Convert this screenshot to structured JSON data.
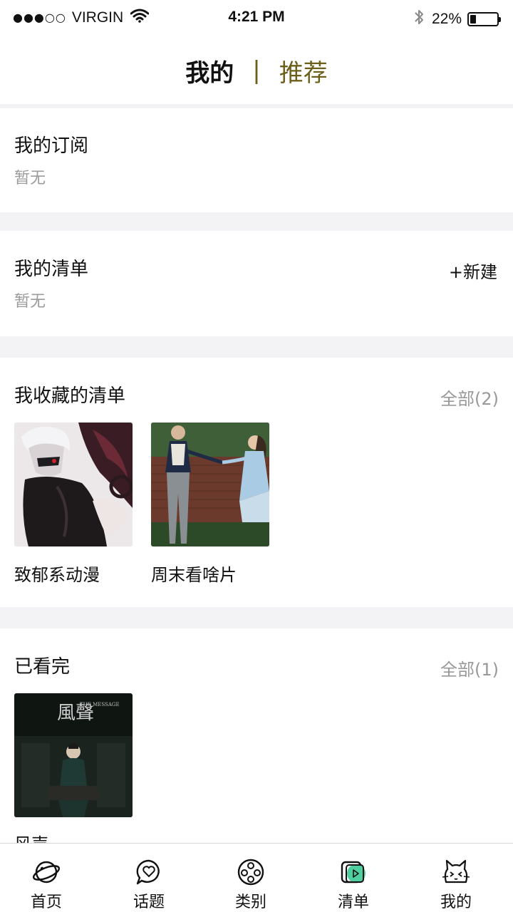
{
  "status": {
    "carrier": "VIRGIN",
    "signal": "●●●○○",
    "time": "4:21 PM",
    "battery": "22%",
    "battery_level": 0.22
  },
  "header": {
    "tab_mine": "我的",
    "separator": "|",
    "tab_recommend": "推荐"
  },
  "subscriptions": {
    "title": "我的订阅",
    "empty": "暂无"
  },
  "my_lists": {
    "title": "我的清单",
    "empty": "暂无",
    "new_label": "+新建"
  },
  "favorites": {
    "title": "我收藏的清单",
    "all_label": "全部(2)",
    "items": [
      {
        "label": "致郁系动漫"
      },
      {
        "label": "周末看啥片"
      }
    ]
  },
  "watched": {
    "title": "已看完",
    "all_label": "全部(1)",
    "items": [
      {
        "label": "风声",
        "poster_title_cn": "風聲",
        "poster_title_en": "THE MESSAGE"
      }
    ]
  },
  "nav": {
    "items": [
      {
        "label": "首页",
        "icon": "planet-icon"
      },
      {
        "label": "话题",
        "icon": "chat-heart-icon"
      },
      {
        "label": "类别",
        "icon": "film-reel-icon"
      },
      {
        "label": "清单",
        "icon": "playlist-icon"
      },
      {
        "label": "我的",
        "icon": "cat-face-icon"
      }
    ],
    "active_index": 3
  },
  "colors": {
    "accent": "#6b5f1a",
    "active_green": "#4fcfa0",
    "divider": "#f3f3f5",
    "muted_text": "#9b9b9b"
  }
}
